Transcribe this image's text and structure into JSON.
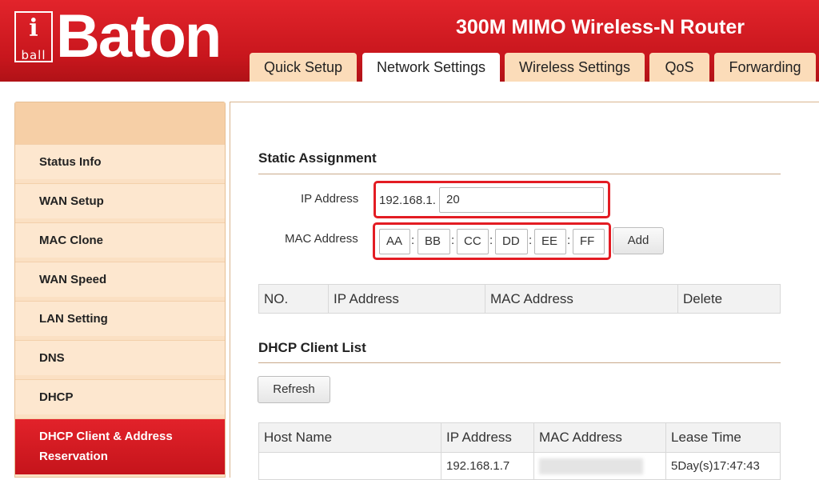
{
  "brand": {
    "logo_i": "i",
    "logo_ball": "ball",
    "logo_name": "Baton",
    "registered": "®"
  },
  "product_title": "300M MIMO Wireless-N Router",
  "tabs": [
    {
      "label": "Quick Setup"
    },
    {
      "label": "Network Settings"
    },
    {
      "label": "Wireless Settings"
    },
    {
      "label": "QoS"
    },
    {
      "label": "Forwarding"
    }
  ],
  "sidebar": {
    "items": [
      {
        "label": "Status Info"
      },
      {
        "label": "WAN Setup"
      },
      {
        "label": "MAC Clone"
      },
      {
        "label": "WAN Speed"
      },
      {
        "label": "LAN Setting"
      },
      {
        "label": "DNS"
      },
      {
        "label": "DHCP"
      },
      {
        "label": "DHCP Client & Address Reservation"
      }
    ]
  },
  "static_assignment": {
    "title": "Static Assignment",
    "ip_label": "IP Address",
    "ip_prefix": "192.168.1.",
    "ip_value": "20",
    "mac_label": "MAC Address",
    "mac_octets": [
      "AA",
      "BB",
      "CC",
      "DD",
      "EE",
      "FF"
    ],
    "separator": ":",
    "add_label": "Add"
  },
  "reservation_table": {
    "headers": [
      "NO.",
      "IP Address",
      "MAC Address",
      "Delete"
    ]
  },
  "dhcp_client_list": {
    "title": "DHCP Client List",
    "refresh_label": "Refresh",
    "headers": [
      "Host Name",
      "IP Address",
      "MAC Address",
      "Lease Time"
    ],
    "rows": [
      {
        "host": "",
        "ip": "192.168.1.7",
        "mac": "",
        "lease": "5Day(s)17:47:43"
      }
    ]
  },
  "colors": {
    "brand_red": "#d41c23",
    "tab_peach": "#fbdcb9",
    "sidebar_bg": "#fde7cf",
    "highlight": "#e31c23"
  }
}
